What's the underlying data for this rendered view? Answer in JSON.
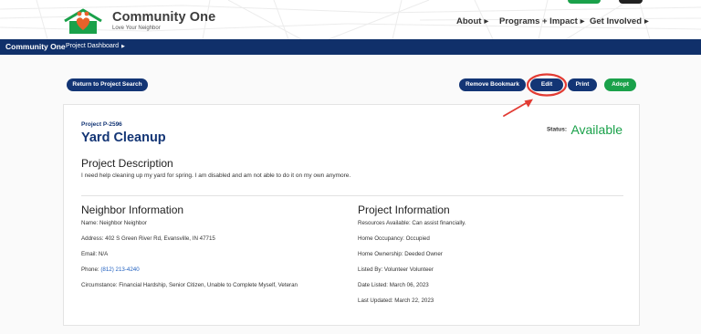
{
  "brand": {
    "name": "Community One",
    "tagline": "Love Your Neighbor"
  },
  "nav": [
    {
      "label": "About"
    },
    {
      "label": "Programs + Impact"
    },
    {
      "label": "Get Involved"
    }
  ],
  "subnav": {
    "brand": "Community One",
    "page": "Project Dashboard"
  },
  "actions": {
    "return": "Return to Project Search",
    "remove_bookmark": "Remove Bookmark",
    "edit": "Edit",
    "print": "Print",
    "adopt": "Adopt"
  },
  "project": {
    "id": "Project P-2596",
    "title": "Yard Cleanup",
    "status_label": "Status:",
    "status_value": "Available",
    "description_heading": "Project Description",
    "description": "I need help cleaning up my yard for spring. I am disabled and am not able to do it on my own anymore."
  },
  "neighbor": {
    "heading": "Neighbor Information",
    "name": "Name: Neighbor Neighbor",
    "address": "Address: 402 S Green River Rd, Evansville, IN 47715",
    "email": "Email: N/A",
    "phone_label": "Phone: ",
    "phone": "(812) 213-4240",
    "circumstance": "Circumstance: Financial Hardship, Senior Citizen, Unable to Complete Myself, Veteran"
  },
  "project_info": {
    "heading": "Project Information",
    "resources": "Resources Available: Can assist financially.",
    "occupancy": "Home Occupancy: Occupied",
    "ownership": "Home Ownership: Deeded Owner",
    "listed_by": "Listed By: Volunteer Volunteer",
    "date_listed": "Date Listed: March 06, 2023",
    "last_updated": "Last Updated: March 22, 2023"
  },
  "colors": {
    "navy": "#133575",
    "green": "#1aa14a",
    "orange": "#e8622a",
    "annotation_red": "#e23b33"
  },
  "icons": [
    "house-heart-logo-icon",
    "chevron-right-icon",
    "red-arrow-annotation",
    "red-circle-annotation"
  ]
}
